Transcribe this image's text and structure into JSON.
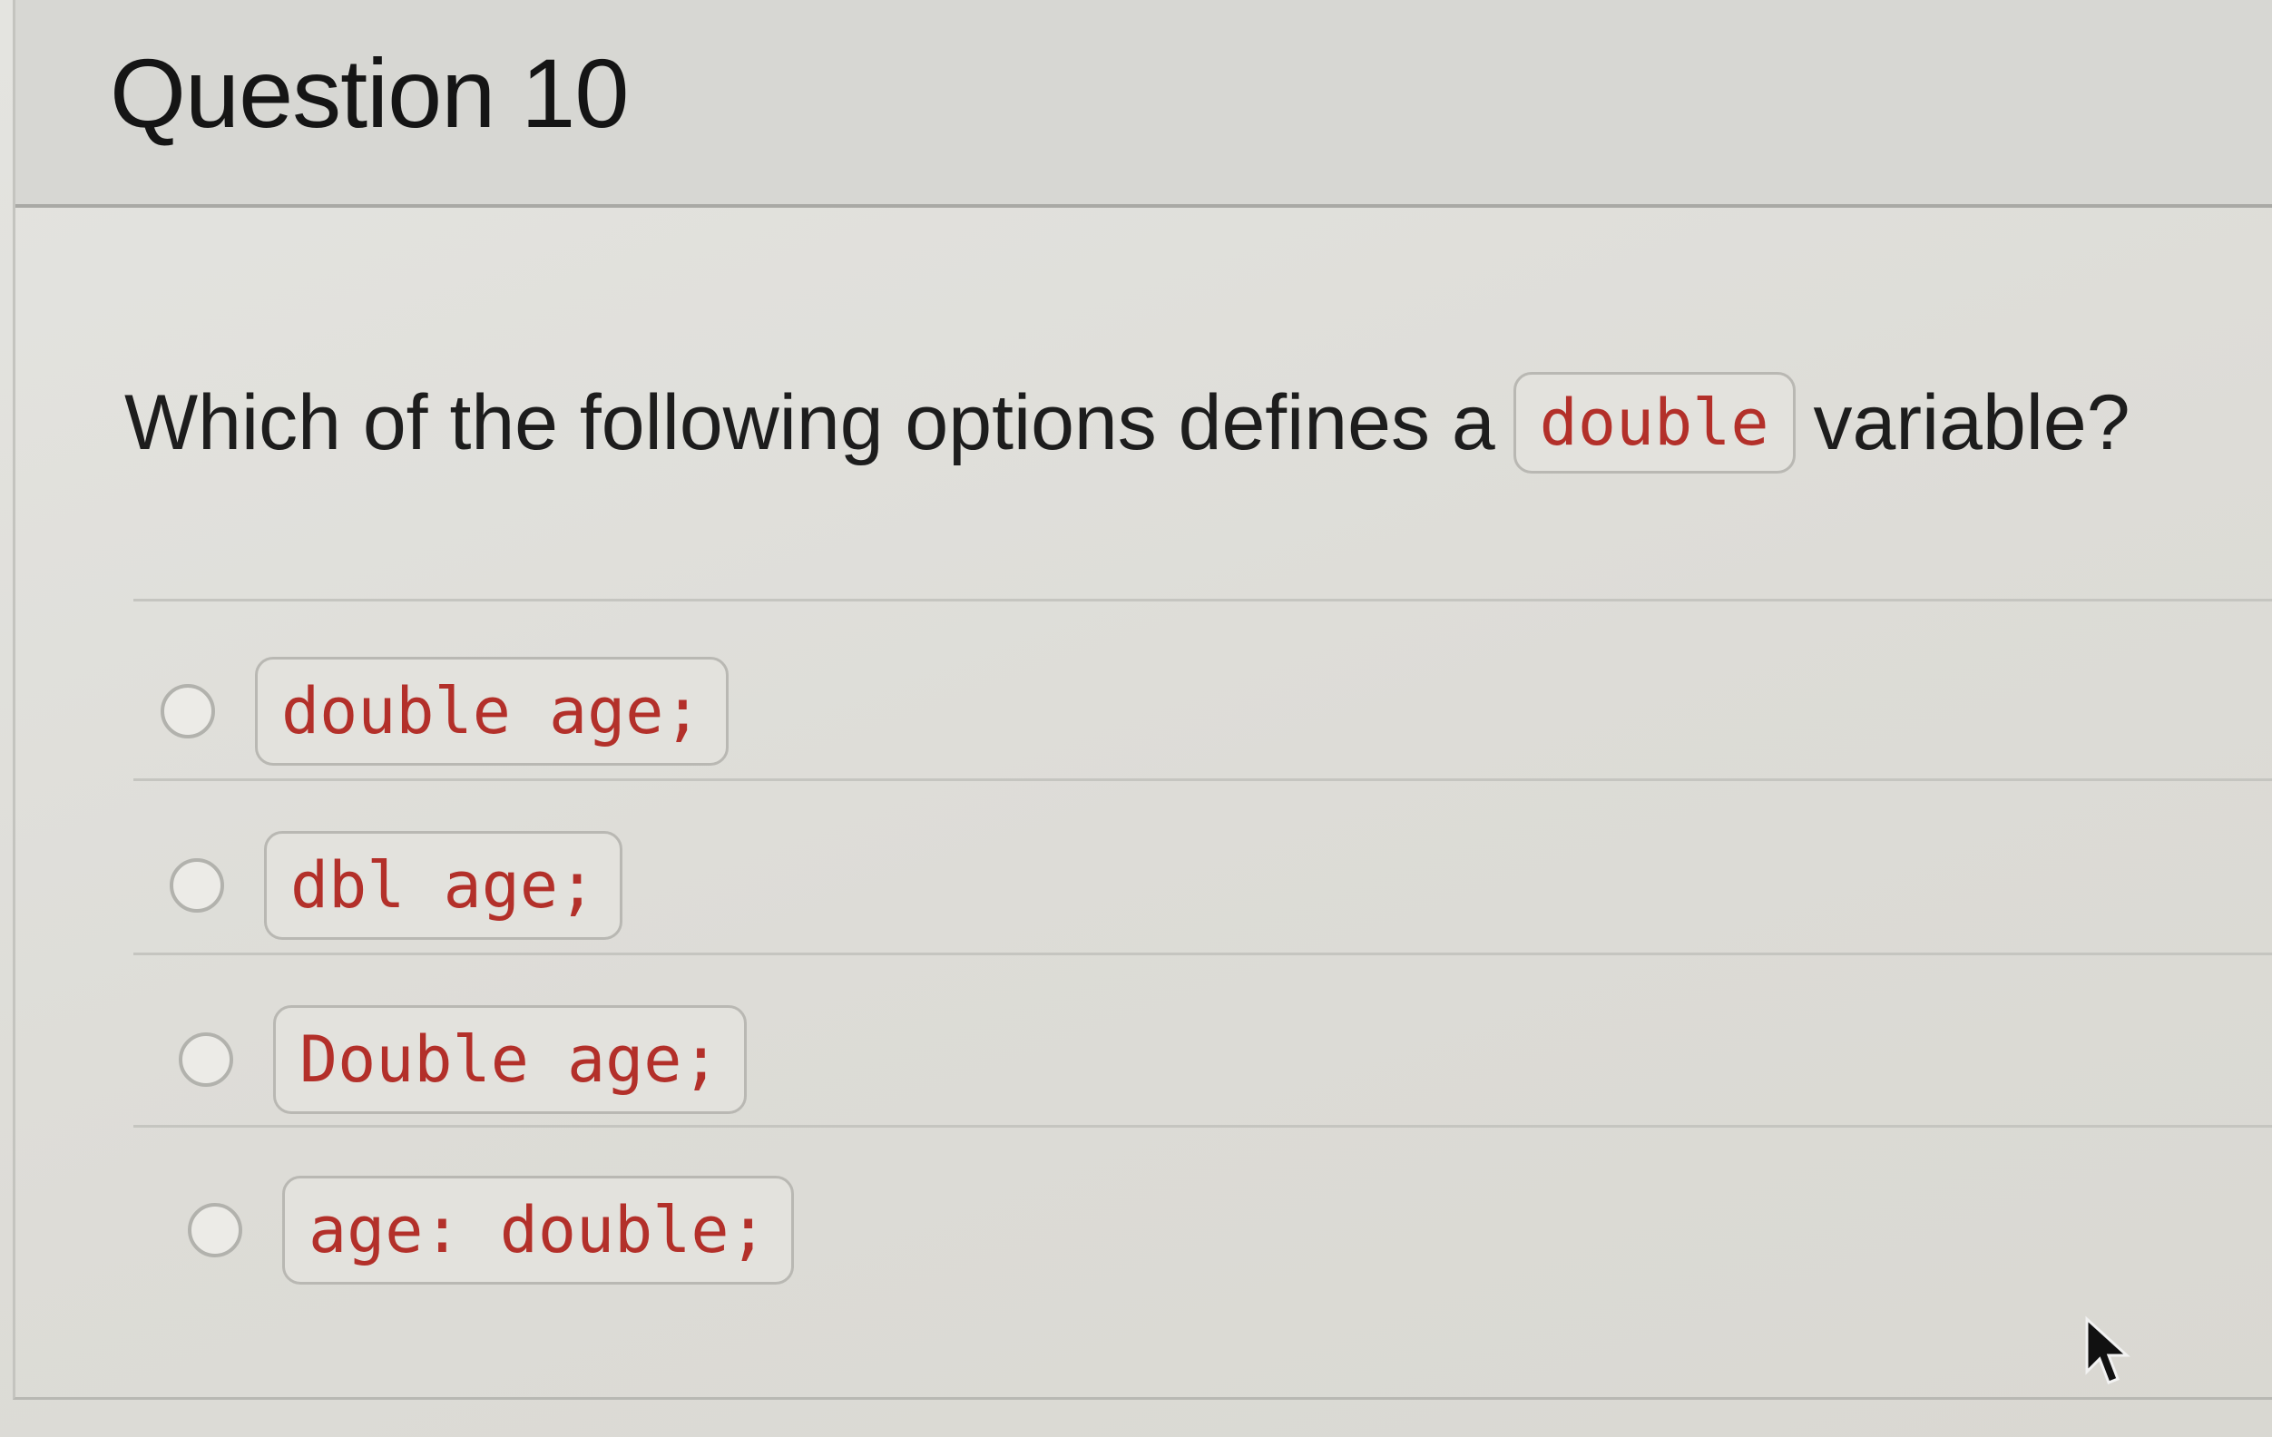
{
  "question": {
    "title": "Question 10",
    "prompt_before": "Which of the following options defines a",
    "prompt_code": "double",
    "prompt_after": "variable?"
  },
  "answers": [
    {
      "code": "double age;"
    },
    {
      "code": "dbl age;"
    },
    {
      "code": "Double age;"
    },
    {
      "code": "age: double;"
    }
  ],
  "icons": {
    "radio": "radio-button-icon",
    "cursor": "mouse-pointer-icon"
  },
  "colors": {
    "code_text": "#b3302a",
    "code_bg": "#e3e2dd",
    "text": "#1d1d1d"
  }
}
